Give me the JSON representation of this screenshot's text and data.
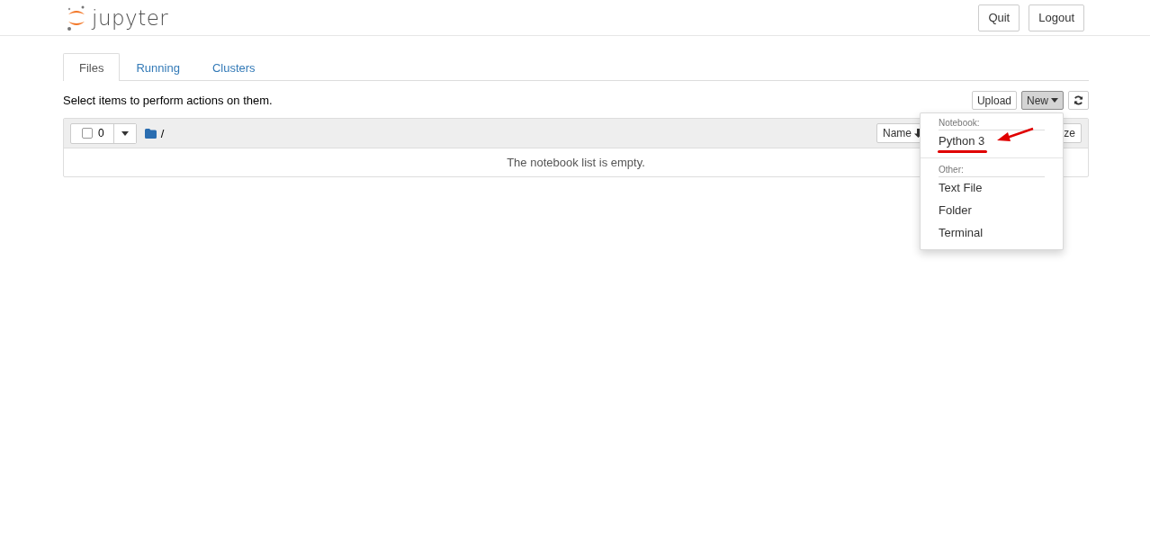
{
  "header": {
    "logo_text": "jupyter",
    "buttons": [
      "Quit",
      "Logout"
    ]
  },
  "tabs": [
    {
      "label": "Files",
      "selected": true
    },
    {
      "label": "Running",
      "selected": false
    },
    {
      "label": "Clusters",
      "selected": false
    }
  ],
  "hint": "Select items to perform actions on them.",
  "toolbar": {
    "buttons": [
      {
        "label": "Upload",
        "kind": "plain",
        "pressed": false
      },
      {
        "label": "New",
        "kind": "dropdown",
        "pressed": true
      },
      {
        "kind": "refresh",
        "pressed": false
      }
    ]
  },
  "list": {
    "select_all_checked": false,
    "selected_count": "0",
    "path": "/",
    "sort_button": "Name",
    "column_fragment": "ze",
    "empty_message": "The notebook list is empty."
  },
  "menu": {
    "sections": [
      {
        "header": "Notebook:",
        "items": [
          {
            "label": "Python 3",
            "annotated": true
          }
        ]
      },
      {
        "header": "Other:",
        "items": [
          {
            "label": "Text File",
            "annotated": false
          },
          {
            "label": "Folder",
            "annotated": false
          },
          {
            "label": "Terminal",
            "annotated": false
          }
        ]
      }
    ]
  }
}
